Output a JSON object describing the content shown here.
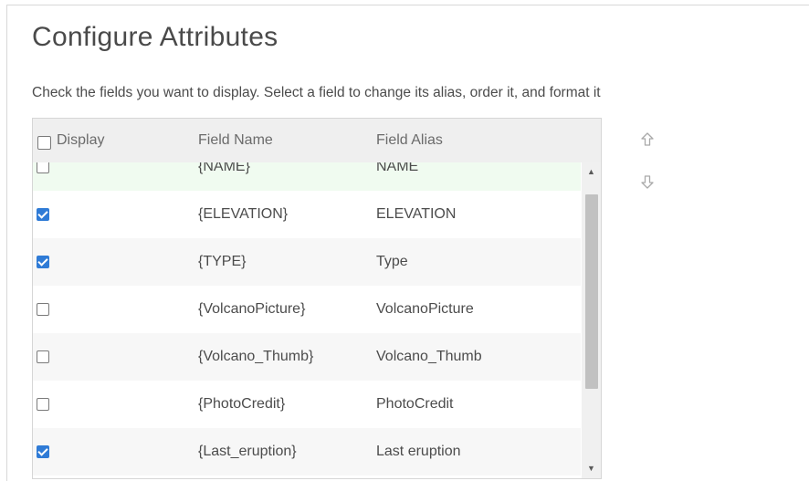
{
  "page": {
    "title": "Configure Attributes",
    "instructions": "Check the fields you want to display. Select a field to change its alias, order it, and format it"
  },
  "table": {
    "headers": {
      "display": "Display",
      "field_name": "Field Name",
      "field_alias": "Field Alias"
    },
    "select_all_checked": false,
    "rows": [
      {
        "checked": false,
        "field": "{NAME}",
        "alias": "NAME"
      },
      {
        "checked": true,
        "field": "{ELEVATION}",
        "alias": "ELEVATION"
      },
      {
        "checked": true,
        "field": "{TYPE}",
        "alias": "Type"
      },
      {
        "checked": false,
        "field": "{VolcanoPicture}",
        "alias": "VolcanoPicture"
      },
      {
        "checked": false,
        "field": "{Volcano_Thumb}",
        "alias": "Volcano_Thumb"
      },
      {
        "checked": false,
        "field": "{PhotoCredit}",
        "alias": "PhotoCredit"
      },
      {
        "checked": true,
        "field": "{Last_eruption}",
        "alias": "Last eruption"
      }
    ]
  },
  "scrollbar": {
    "up_icon": "triangle-up-icon",
    "down_icon": "triangle-down-icon"
  },
  "controls": {
    "move_up_icon": "arrow-up-outline-icon",
    "move_down_icon": "arrow-down-outline-icon"
  },
  "colors": {
    "checkbox_checked": "#2f7bd6",
    "header_bg": "#efefef",
    "alt_row_bg": "#f7f7f7",
    "highlight_row_bg": "#f0fbf0"
  }
}
